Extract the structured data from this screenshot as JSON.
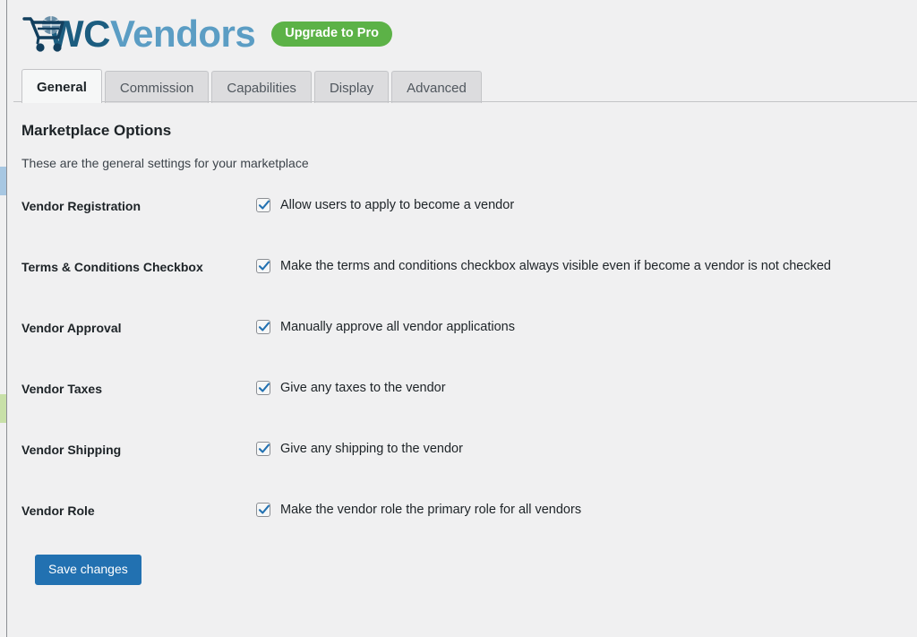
{
  "sidebar_sliver": {
    "accent_blue": "#a7c7e2",
    "accent_green": "#c8e0a8"
  },
  "header": {
    "logo_icon": "shopping-cart-globe-icon",
    "wordmark_primary": "WC",
    "wordmark_secondary": "Vendors",
    "wordmark_primary_color": "#1c5d80",
    "wordmark_secondary_color": "#5b9dc4",
    "upgrade_badge": "Upgrade to Pro",
    "upgrade_badge_color": "#5cb247"
  },
  "tabs": [
    {
      "label": "General",
      "active": true
    },
    {
      "label": "Commission",
      "active": false
    },
    {
      "label": "Capabilities",
      "active": false
    },
    {
      "label": "Display",
      "active": false
    },
    {
      "label": "Advanced",
      "active": false
    }
  ],
  "main": {
    "section_title": "Marketplace Options",
    "section_description": "These are the general settings for your marketplace",
    "settings": [
      {
        "label": "Vendor Registration",
        "description": "Allow users to apply to become a vendor",
        "checked": true
      },
      {
        "label": "Terms & Conditions Checkbox",
        "description": "Make the terms and conditions checkbox always visible even if become a vendor is not checked",
        "checked": true
      },
      {
        "label": "Vendor Approval",
        "description": "Manually approve all vendor applications",
        "checked": true
      },
      {
        "label": "Vendor Taxes",
        "description": "Give any taxes to the vendor",
        "checked": true
      },
      {
        "label": "Vendor Shipping",
        "description": "Give any shipping to the vendor",
        "checked": true
      },
      {
        "label": "Vendor Role",
        "description": "Make the vendor role the primary role for all vendors",
        "checked": true
      }
    ]
  },
  "footer": {
    "save_label": "Save changes",
    "save_color": "#2271b1"
  }
}
